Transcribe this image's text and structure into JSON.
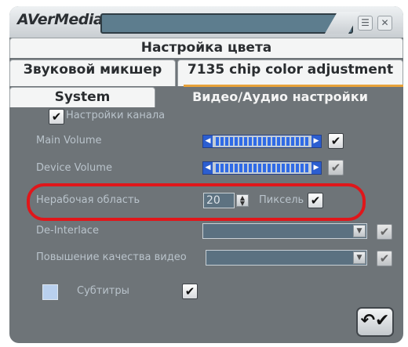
{
  "app": {
    "logo": "AVerMedia"
  },
  "titlebar": {
    "menu_icon": "menu-icon",
    "close_icon": "close-icon"
  },
  "tabs": [
    {
      "label": "Настройка цвета"
    },
    {
      "label": "Звуковой микшер"
    },
    {
      "label": "7135 chip color adjustment"
    },
    {
      "label": "System"
    },
    {
      "label": "Видео/Аудио настройки",
      "active": true
    }
  ],
  "settings": {
    "channel_checkbox_label": "Настройки канала",
    "main_volume_label": "Main Volume",
    "device_volume_label": "Device Volume",
    "inactive_area_label": "Нерабочая область",
    "inactive_area_value": "20",
    "pixel_label": "Пиксель",
    "deinterlace_label": "De-Interlace",
    "enhance_label": "Повышение качества видео",
    "subtitles_label": "Субтитры"
  },
  "sliders": {
    "main_volume_level": 0.88,
    "device_volume_level": 0.88
  },
  "colors": {
    "accent_orange": "#e8a23a",
    "highlight_red": "#e0161a",
    "panel": "#6e7478"
  }
}
